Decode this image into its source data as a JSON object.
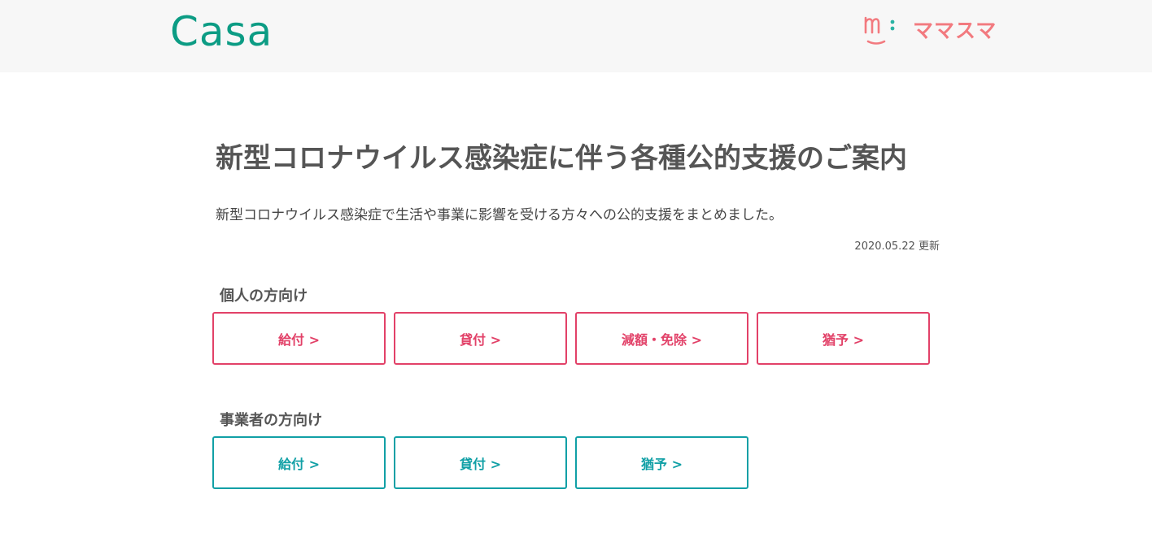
{
  "header": {
    "casa_logo": "Casa",
    "mamasuma_logo": "ママスマ"
  },
  "colors": {
    "casa_green": "#0c9c84",
    "mamasuma_pink": "#f27a7f",
    "individual_accent": "#e24168",
    "business_accent": "#11a0a6",
    "header_bg": "#f7f7f7"
  },
  "main": {
    "title": "新型コロナウイルス感染症に伴う各種公的支援のご案内",
    "lead": "新型コロナウイルス感染症で生活や事業に影響を受ける方々への公的支援をまとめました。",
    "updated": "2020.05.22 更新"
  },
  "individual": {
    "heading": "個人の方向け",
    "buttons": [
      {
        "label": "給付 >"
      },
      {
        "label": "貸付 >"
      },
      {
        "label": "減額・免除 >"
      },
      {
        "label": "猶予 >"
      }
    ]
  },
  "business": {
    "heading": "事業者の方向け",
    "buttons": [
      {
        "label": "給付 >"
      },
      {
        "label": "貸付 >"
      },
      {
        "label": "猶予 >"
      }
    ]
  }
}
